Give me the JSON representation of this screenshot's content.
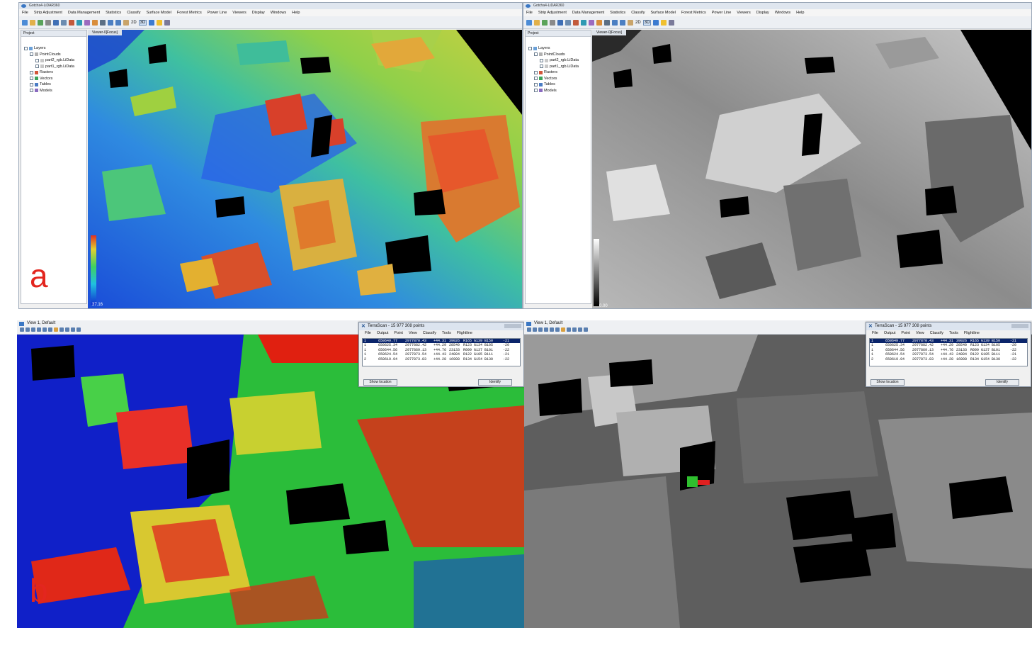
{
  "top_app": {
    "title": "Gotcha4-LiDAR360",
    "menu": [
      "File",
      "Strip Adjustment",
      "Data Management",
      "Statistics",
      "Classify",
      "Surface Model",
      "Forest Metrics",
      "Power Line",
      "Viewers",
      "Display",
      "Windows",
      "Help"
    ],
    "toolbar_labels": {
      "view_2d": "2D",
      "view_3d": "3D"
    },
    "project_panel": {
      "title": "Project",
      "tree": {
        "layers": "Layers",
        "pointclouds": "PointClouds",
        "file1": "part2_rgb.LiData",
        "file2": "part1_rgb.LiData",
        "rasters": "Rasters",
        "vectors": "Vectors",
        "tables": "Tables",
        "models": "Models"
      }
    },
    "viewer_tab": "Viewer-0[Focus]",
    "left_colorbar_value": "37.16",
    "right_colorbar_value": "0.00"
  },
  "bottom_app": {
    "view_title": "View 1, Default",
    "terrascan": {
      "title": "TerraScan - 15 977 308 points",
      "menu": [
        "File",
        "Output",
        "Point",
        "View",
        "Classify",
        "Tools",
        "Flightline"
      ],
      "rows": [
        {
          "c1": "1",
          "c2": "650649.77",
          "c3": "2977870.43",
          "c4": "+44.31",
          "c5": "39026",
          "c6": "R165 G139 B150",
          "c7": "-21"
        },
        {
          "c1": "1",
          "c2": "650625.34",
          "c3": "2977882.42",
          "c4": "+44.29",
          "c5": "28540",
          "c6": "R123 G134 B105",
          "c7": "-20"
        },
        {
          "c1": "1",
          "c2": "650644.56",
          "c3": "2977869.13",
          "c4": "+44.76",
          "c5": "23133",
          "c6": "R099 G137 B101",
          "c7": "-22"
        },
        {
          "c1": "1",
          "c2": "650624.54",
          "c3": "2977873.54",
          "c4": "+44.43",
          "c5": "24804",
          "c6": "R122 G105 B111",
          "c7": "-21"
        },
        {
          "c1": "2",
          "c2": "650619.94",
          "c3": "2977873.83",
          "c4": "+44.28",
          "c5": "16908",
          "c6": "R134 G154 B130",
          "c7": "-22"
        }
      ],
      "show_location": "Show location",
      "identify": "Identify"
    }
  },
  "labels": {
    "a": "a",
    "b": "b"
  },
  "colors": {
    "accent_label": "#e3261f",
    "selection": "#0a246a"
  }
}
